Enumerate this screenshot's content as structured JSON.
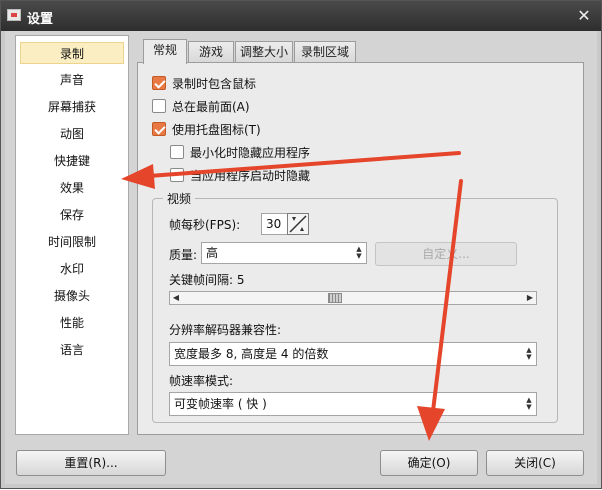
{
  "window": {
    "title": "设置"
  },
  "sidebar": {
    "items": [
      {
        "label": "录制",
        "active": true
      },
      {
        "label": "声音"
      },
      {
        "label": "屏幕捕获"
      },
      {
        "label": "动图"
      },
      {
        "label": "快捷键"
      },
      {
        "label": "效果"
      },
      {
        "label": "保存"
      },
      {
        "label": "时间限制"
      },
      {
        "label": "水印"
      },
      {
        "label": "摄像头"
      },
      {
        "label": "性能"
      },
      {
        "label": "语言"
      }
    ]
  },
  "tabs": [
    {
      "label": "常规",
      "active": true
    },
    {
      "label": "游戏"
    },
    {
      "label": "调整大小"
    },
    {
      "label": "录制区域"
    }
  ],
  "general": {
    "options": [
      {
        "label": "录制时包含鼠标",
        "checked": true
      },
      {
        "label": "总在最前面(A)",
        "checked": false
      },
      {
        "label": "使用托盘图标(T)",
        "checked": true
      },
      {
        "label": "最小化时隐藏应用程序",
        "checked": false
      },
      {
        "label": "当应用程序启动时隐藏",
        "checked": false
      }
    ],
    "video": {
      "title": "视频",
      "fps_label": "帧每秒(FPS):",
      "fps_value": "30",
      "quality_label": "质量:",
      "quality_value": "高",
      "custom_button": "自定义...",
      "keyframe_label": "关键帧间隔: 5",
      "keyframe_value": 5,
      "resolution_label": "分辨率解码器兼容性:",
      "resolution_value": "宽度最多 8, 高度是 4 的倍数",
      "fps_mode_label": "帧速率模式:",
      "fps_mode_value": "可变帧速率 ( 快 )"
    }
  },
  "footer": {
    "reset_button": "重置(R)...",
    "ok_button": "确定(O)",
    "close_button": "关闭(C)"
  },
  "colors": {
    "accent_check": "#e87944",
    "annotation_arrow": "#e5452a",
    "selected_item": "#fbeec3"
  },
  "icons": {
    "close": "close-icon",
    "app": "app-icon",
    "spin": "spin-arrows-icon",
    "fps_toggle": "fps-toggle-icon"
  }
}
